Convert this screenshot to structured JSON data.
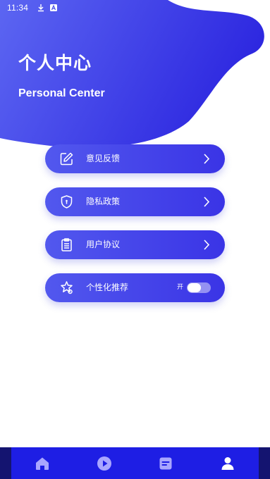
{
  "status_bar": {
    "time": "11:34",
    "icons": [
      "download-icon",
      "a-letter-icon"
    ]
  },
  "header": {
    "title": "个人中心",
    "subtitle": "Personal Center"
  },
  "menu": {
    "items": [
      {
        "label": "意见反馈",
        "icon": "edit-icon",
        "action_icon": "chevron-right-icon"
      },
      {
        "label": "隐私政策",
        "icon": "shield-icon",
        "action_icon": "chevron-right-icon"
      },
      {
        "label": "用户协议",
        "icon": "clipboard-icon",
        "action_icon": "chevron-right-icon"
      },
      {
        "label": "个性化推荐",
        "icon": "star-badge-icon",
        "toggle_label": "开",
        "toggle_on": true
      }
    ]
  },
  "bottom_nav": {
    "tabs": [
      {
        "icon": "home-icon"
      },
      {
        "icon": "play-circle-icon"
      },
      {
        "icon": "document-icon"
      },
      {
        "icon": "user-icon",
        "active": true
      }
    ]
  },
  "colors": {
    "primary": "#3a34e6",
    "gradient_start": "#5258ee",
    "nav_bg": "#1e1ee4",
    "nav_edge": "#141470",
    "nav_icon_inactive": "#a9a6ff",
    "nav_icon_active": "#ffffff"
  }
}
